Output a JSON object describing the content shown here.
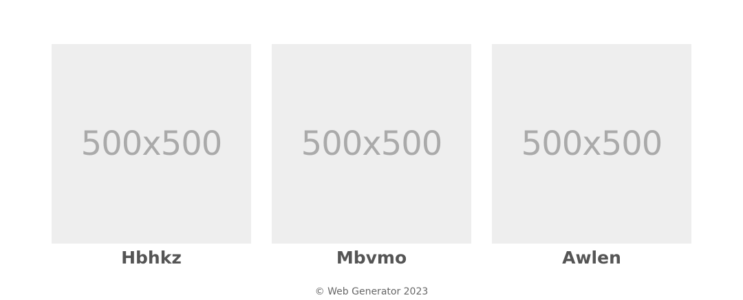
{
  "gallery": {
    "items": [
      {
        "placeholder_text": "500x500",
        "title": "Hbhkz"
      },
      {
        "placeholder_text": "500x500",
        "title": "Mbvmo"
      },
      {
        "placeholder_text": "500x500",
        "title": "Awlen"
      }
    ]
  },
  "footer": {
    "text": "© Web Generator 2023"
  },
  "colors": {
    "background": "#ffffff",
    "placeholder_bg": "#eeeeee",
    "placeholder_text": "#aaaaaa",
    "title_text": "#555555",
    "footer_text": "#666666"
  }
}
